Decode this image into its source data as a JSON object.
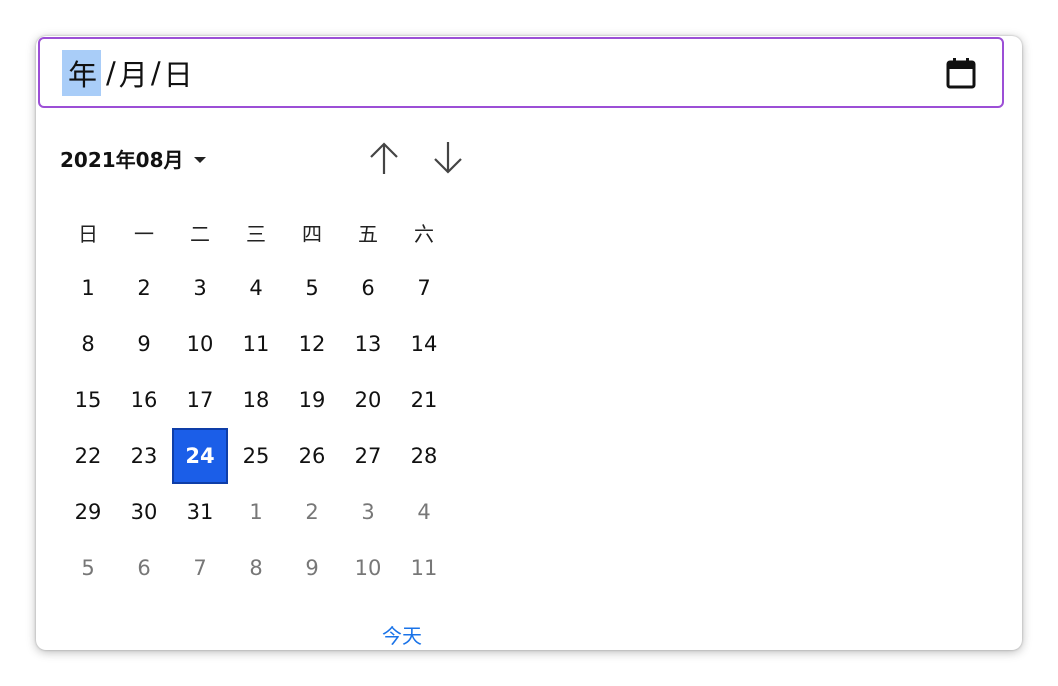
{
  "input": {
    "year": "年",
    "sep1": "/",
    "month": "月",
    "sep2": "/",
    "day": "日",
    "calendar_icon": "calendar-icon"
  },
  "picker": {
    "month_label": "2021年08月",
    "prev_icon": "arrow-up-icon",
    "next_icon": "arrow-down-icon",
    "weekdays": [
      "日",
      "一",
      "二",
      "三",
      "四",
      "五",
      "六"
    ],
    "weeks": [
      [
        "1",
        "2",
        "3",
        "4",
        "5",
        "6",
        "7"
      ],
      [
        "8",
        "9",
        "10",
        "11",
        "12",
        "13",
        "14"
      ],
      [
        "15",
        "16",
        "17",
        "18",
        "19",
        "20",
        "21"
      ],
      [
        "22",
        "23",
        "24",
        "25",
        "26",
        "27",
        "28"
      ],
      [
        "29",
        "30",
        "31",
        "1",
        "2",
        "3",
        "4"
      ],
      [
        "5",
        "6",
        "7",
        "8",
        "9",
        "10",
        "11"
      ]
    ],
    "selected_day": "24",
    "today_label": "今天"
  },
  "colors": {
    "focus_border": "#9c4fd6",
    "selected_bg": "#1b5ee8",
    "today_link": "#1a73e8"
  }
}
